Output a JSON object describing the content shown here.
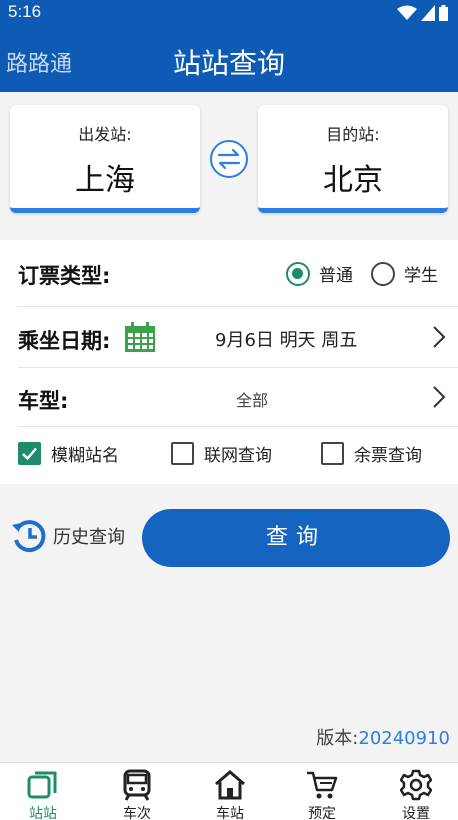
{
  "status_bar": {
    "time": "5:16"
  },
  "app_bar": {
    "app_name": "路路通",
    "title": "站站查询"
  },
  "stations": {
    "from_label": "出发站:",
    "from_name": "上海",
    "to_label": "目的站:",
    "to_name": "北京"
  },
  "form": {
    "ticket_type_label": "订票类型:",
    "ticket_options": [
      {
        "label": "普通",
        "selected": true
      },
      {
        "label": "学生",
        "selected": false
      }
    ],
    "date_label": "乘坐日期:",
    "date_value": "9月6日 明天 周五",
    "train_type_label": "车型:",
    "train_type_value": "全部",
    "options": [
      {
        "label": "模糊站名",
        "checked": true
      },
      {
        "label": "联网查询",
        "checked": false
      },
      {
        "label": "余票查询",
        "checked": false
      }
    ]
  },
  "actions": {
    "history_label": "历史查询",
    "query_label": "查询"
  },
  "version": {
    "prefix": "版本:",
    "number": "20240910"
  },
  "bottom_nav": [
    {
      "label": "站站",
      "icon": "station-to-station-icon",
      "active": true
    },
    {
      "label": "车次",
      "icon": "train-icon",
      "active": false
    },
    {
      "label": "车站",
      "icon": "home-station-icon",
      "active": false
    },
    {
      "label": "预定",
      "icon": "cart-icon",
      "active": false
    },
    {
      "label": "设置",
      "icon": "gear-icon",
      "active": false
    }
  ],
  "colors": {
    "primary": "#0d5bb5",
    "accent": "#1e8c6b",
    "button": "#1565c0",
    "link": "#2a7fe0"
  }
}
